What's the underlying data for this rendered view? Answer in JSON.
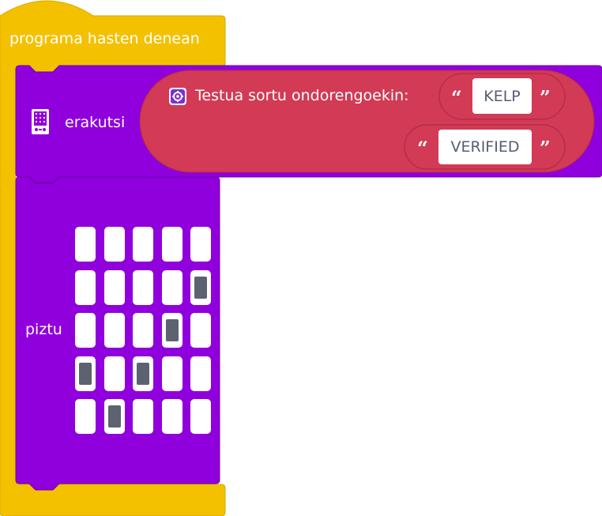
{
  "workspace": {
    "on_start_block": {
      "label": "programa hasten denean",
      "color": "#f4c100"
    },
    "show_string_block": {
      "label": "erakutsi",
      "color": "#9000dd",
      "join_block": {
        "label": "Testua sortu ondorengoekin:",
        "color": "#d23a55",
        "items": [
          "KELP",
          "VERIFIED"
        ]
      }
    },
    "show_leds_block": {
      "label": "piztu",
      "color": "#9000dd",
      "grid": [
        [
          0,
          0,
          0,
          0,
          0
        ],
        [
          0,
          0,
          0,
          0,
          1
        ],
        [
          0,
          0,
          0,
          1,
          0
        ],
        [
          1,
          0,
          1,
          0,
          0
        ],
        [
          0,
          1,
          0,
          0,
          0
        ]
      ]
    },
    "quote_open": "“",
    "quote_close": "”"
  }
}
